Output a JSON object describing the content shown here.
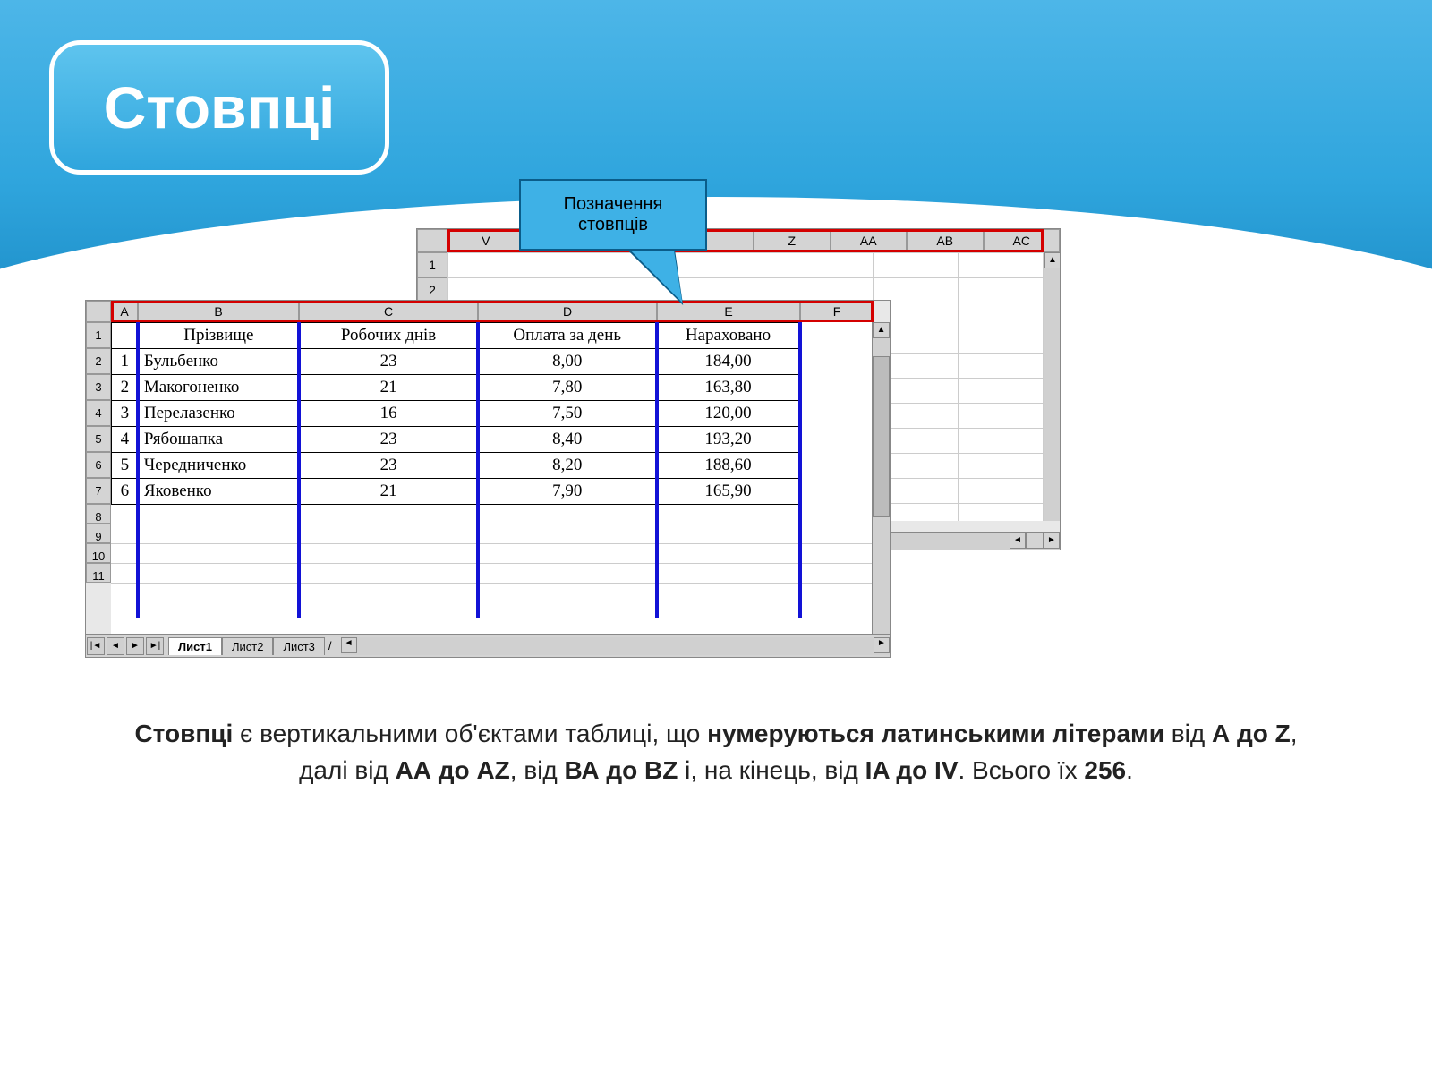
{
  "title": "Стовпці",
  "callout": {
    "line1": "Позначення",
    "line2": "стовпців"
  },
  "back_sheet": {
    "columns": [
      "V",
      "",
      "",
      "",
      "Z",
      "AA",
      "AB",
      "AC"
    ],
    "rows": [
      "1",
      "2"
    ]
  },
  "front_sheet": {
    "columns": [
      "A",
      "B",
      "C",
      "D",
      "E",
      "F"
    ],
    "rows": [
      "1",
      "2",
      "3",
      "4",
      "5",
      "6",
      "7",
      "8",
      "9",
      "10",
      "11"
    ],
    "header_row": [
      "",
      "Прізвище",
      "Робочих днів",
      "Оплата за день",
      "Нараховано"
    ],
    "data": [
      [
        "1",
        "Бульбенко",
        "23",
        "8,00",
        "184,00"
      ],
      [
        "2",
        "Макогоненко",
        "21",
        "7,80",
        "163,80"
      ],
      [
        "3",
        "Перелазенко",
        "16",
        "7,50",
        "120,00"
      ],
      [
        "4",
        "Рябошапка",
        "23",
        "8,40",
        "193,20"
      ],
      [
        "5",
        "Чередниченко",
        "23",
        "8,20",
        "188,60"
      ],
      [
        "6",
        "Яковенко",
        "21",
        "7,90",
        "165,90"
      ]
    ],
    "tabs": [
      "Лист1",
      "Лист2",
      "Лист3"
    ]
  },
  "description": {
    "p1a": "Стовпці",
    "p1b": " є вертикальними об'єктами таблиці, що ",
    "p1c": "нумеруються латинськими літерами",
    "p1d": " від ",
    "p1e": "А до Z",
    "p1f": ", далі від ",
    "p1g": "АА до AZ",
    "p1h": ", від ",
    "p1i": "ВА до BZ",
    "p1j": " і, на кінець, від ",
    "p1k": "IA до IV",
    "p1l": ". Всього їх ",
    "p1m": "256",
    "p1n": "."
  }
}
